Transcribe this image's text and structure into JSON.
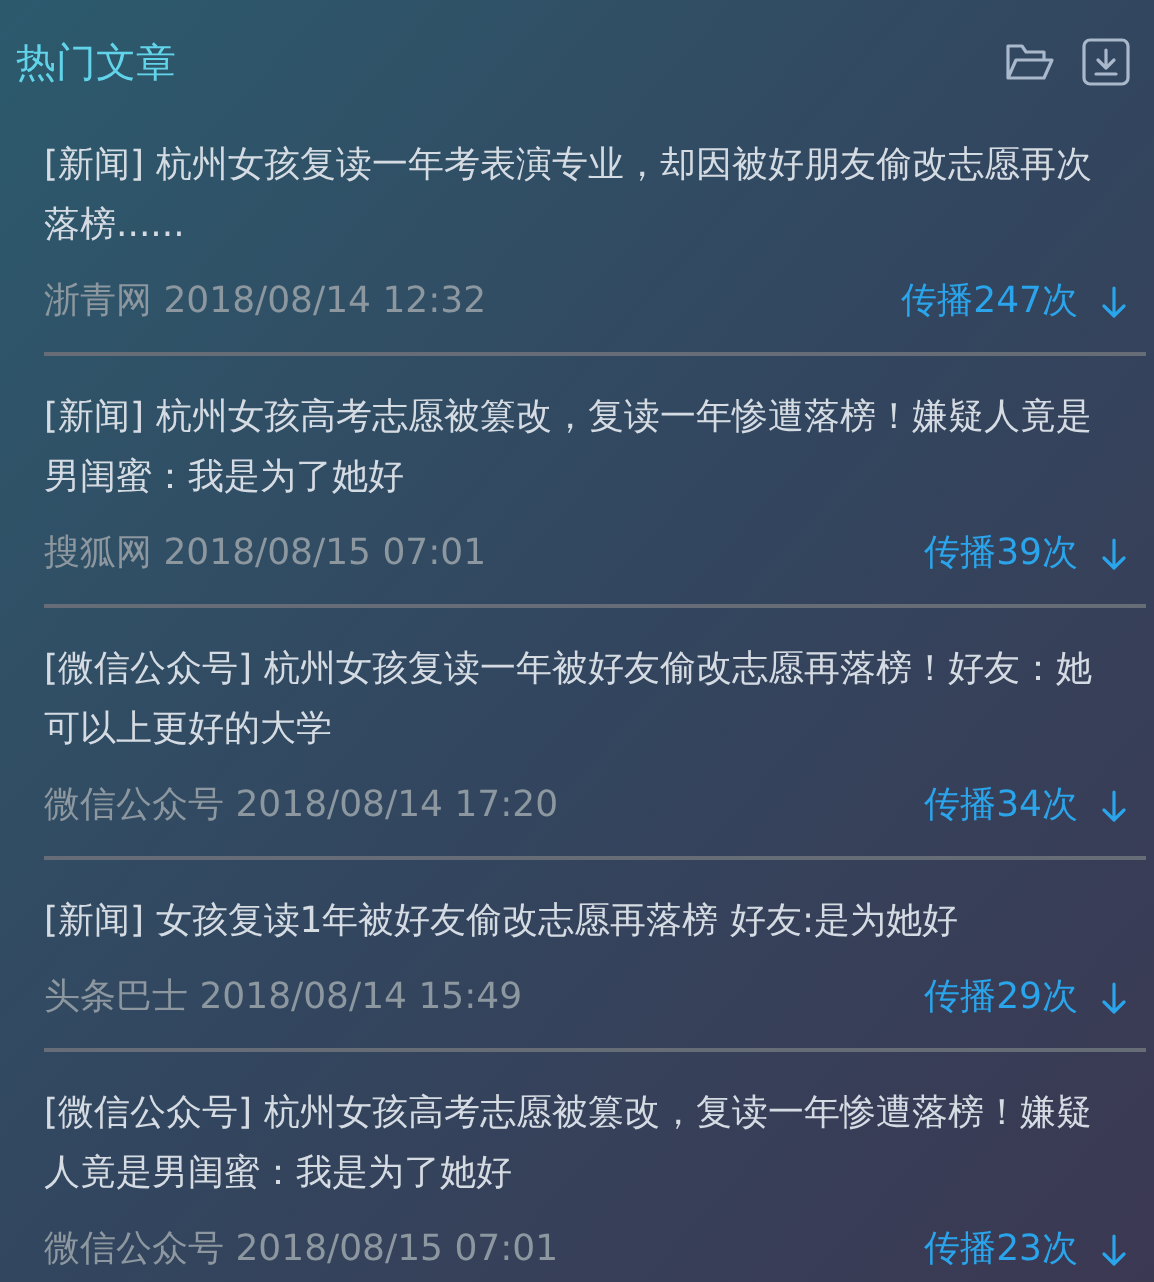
{
  "panel": {
    "title": "热门文章"
  },
  "articles": [
    {
      "tag": "[新闻]",
      "headline": "杭州女孩复读一年考表演专业，却因被好朋友偷改志愿再次落榜......",
      "source": "浙青网",
      "time": "2018/08/14 12:32",
      "shares": "传播247次"
    },
    {
      "tag": "[新闻]",
      "headline": "杭州女孩高考志愿被篡改，复读一年惨遭落榜！嫌疑人竟是男闺蜜：我是为了她好",
      "source": "搜狐网",
      "time": "2018/08/15 07:01",
      "shares": "传播39次"
    },
    {
      "tag": "[微信公众号]",
      "headline": "杭州女孩复读一年被好友偷改志愿再落榜！好友：她可以上更好的大学",
      "source": "微信公众号",
      "time": "2018/08/14 17:20",
      "shares": "传播34次"
    },
    {
      "tag": "[新闻]",
      "headline": "女孩复读1年被好友偷改志愿再落榜 好友:是为她好",
      "source": "头条巴士",
      "time": "2018/08/14 15:49",
      "shares": "传播29次"
    },
    {
      "tag": "[微信公众号]",
      "headline": "杭州女孩高考志愿被篡改，复读一年惨遭落榜！嫌疑人竟是男闺蜜：我是为了她好",
      "source": "微信公众号",
      "time": "2018/08/15 07:01",
      "shares": "传播23次"
    }
  ]
}
